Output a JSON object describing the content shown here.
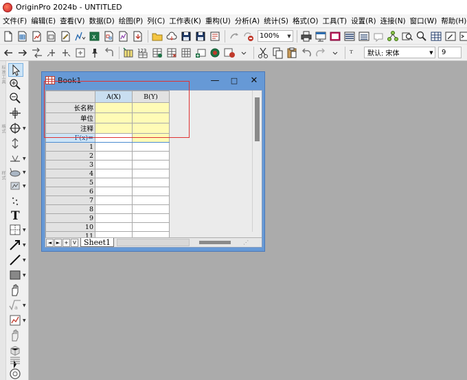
{
  "app": {
    "title": "OriginPro 2024b - UNTITLED"
  },
  "menu": [
    "文件(F)",
    "编辑(E)",
    "查看(V)",
    "数据(D)",
    "绘图(P)",
    "列(C)",
    "工作表(K)",
    "重构(U)",
    "分析(A)",
    "统计(S)",
    "格式(O)",
    "工具(T)",
    "设置(R)",
    "连接(N)",
    "窗口(W)",
    "帮助(H)"
  ],
  "toolbar": {
    "zoom": "100%",
    "font": "默认: 宋体",
    "font_size": "9"
  },
  "left_toolbar": {
    "grip_labels": [
      "标准工具",
      "格式",
      "样式"
    ]
  },
  "workbook": {
    "title": "Book1",
    "window_buttons": {
      "minimize": "—",
      "maximize": "□",
      "close": "✕"
    },
    "columns": [
      "A(X)",
      "B(Y)"
    ],
    "meta_rows": [
      "长名称",
      "单位",
      "注释",
      "F(x)="
    ],
    "rows": [
      "1",
      "2",
      "3",
      "4",
      "5",
      "6",
      "7",
      "8",
      "9",
      "10",
      "11"
    ],
    "sheet_tab": "Sheet1",
    "nav": [
      "◄",
      "►",
      "+",
      "V"
    ]
  },
  "colors": {
    "accent": "#6699d6",
    "meta_cell": "#fffbb6",
    "highlight": "#e03131"
  }
}
